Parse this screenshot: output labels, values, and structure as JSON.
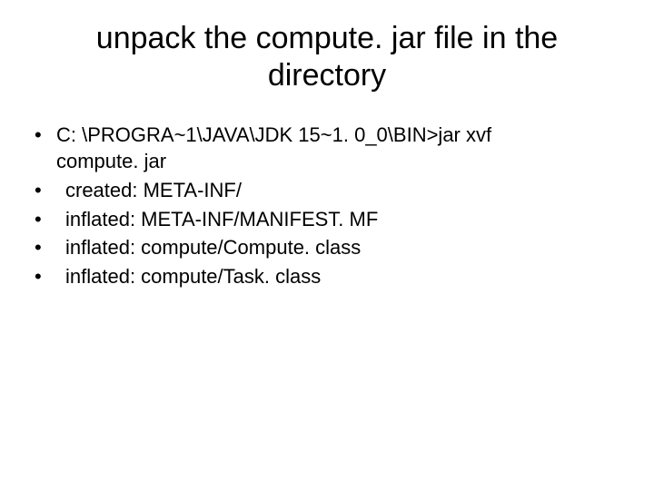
{
  "title": "unpack the compute. jar file in the directory",
  "items": [
    {
      "line1": "C: \\PROGRA~1\\JAVA\\JDK 15~1. 0_0\\BIN>jar xvf",
      "line2": "compute. jar"
    },
    {
      "text": " created: META-INF/"
    },
    {
      "text": " inflated: META-INF/MANIFEST. MF"
    },
    {
      "text": " inflated: compute/Compute. class"
    },
    {
      "text": " inflated: compute/Task. class"
    }
  ]
}
